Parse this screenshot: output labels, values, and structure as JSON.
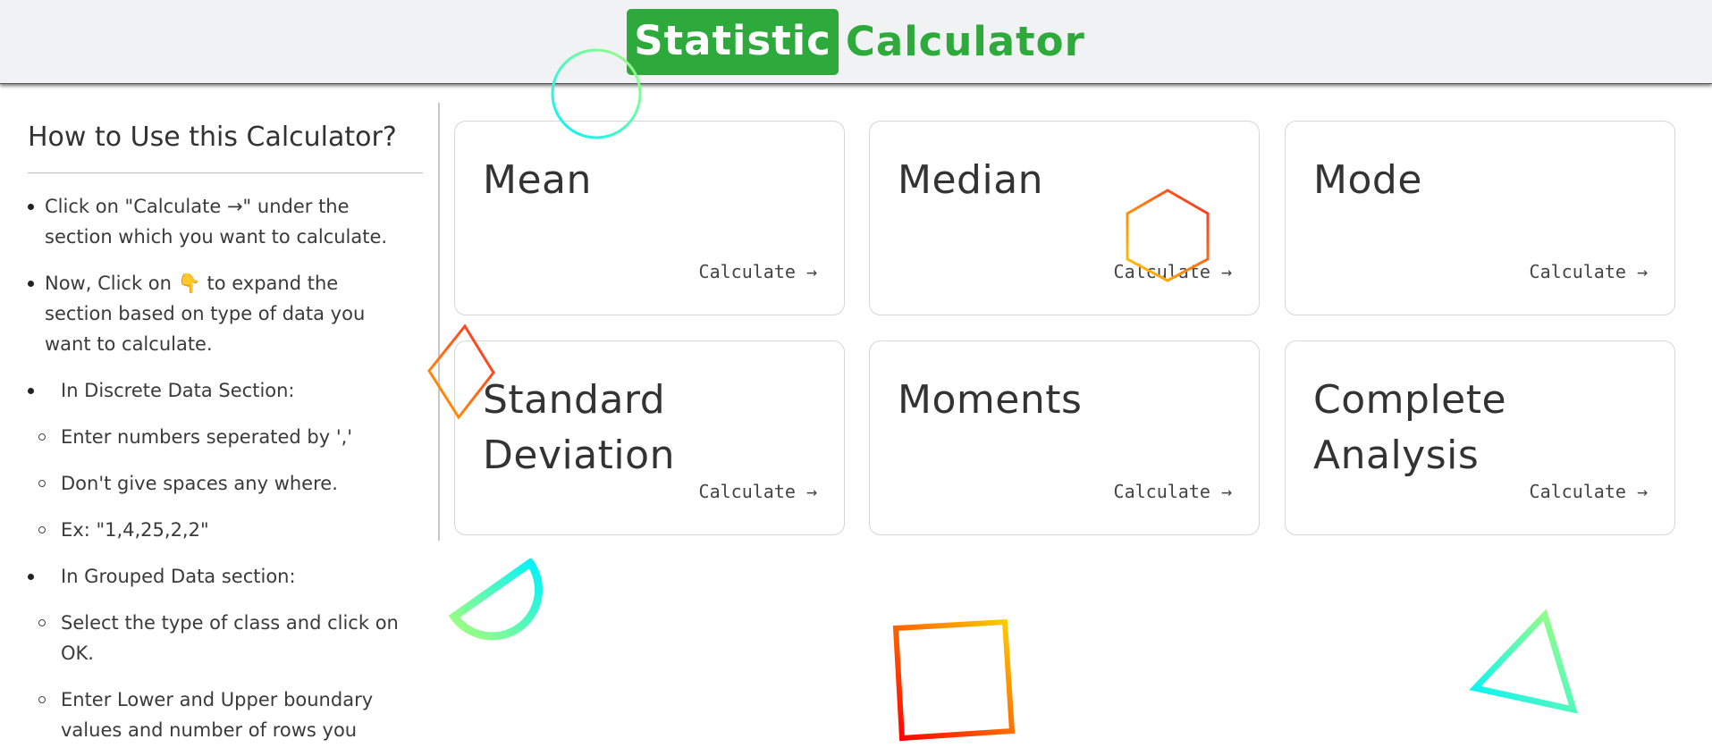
{
  "header": {
    "brand_box": "Statistic",
    "brand_text": "Calculator",
    "brand_color": "#2eaa3c"
  },
  "sidebar": {
    "title": "How to Use this Calculator?",
    "items": [
      {
        "text": "Click on \"Calculate →\" under the section which you want to calculate.",
        "level": 1
      },
      {
        "text_before": "Now, Click on ",
        "emoji": "👇",
        "text_after": " to expand the section based on type of data you want to calculate.",
        "level": 1
      },
      {
        "text": "In Discrete Data Section:",
        "level": 1
      },
      {
        "text": "Enter numbers seperated by ','",
        "level": 2
      },
      {
        "text": "Don't give spaces any where.",
        "level": 2
      },
      {
        "text": "Ex: \"1,4,25,2,2\"",
        "level": 2
      },
      {
        "text": "In Grouped Data section:",
        "level": 1
      },
      {
        "text": "Select the type of class and click on OK.",
        "level": 2
      },
      {
        "text": "Enter Lower and Upper boundary values and number of rows you",
        "level": 2
      }
    ]
  },
  "cards": [
    {
      "title": "Mean",
      "link": "Calculate →"
    },
    {
      "title": "Median",
      "link": "Calculate →"
    },
    {
      "title": "Mode",
      "link": "Calculate →"
    },
    {
      "title": "Standard Deviation",
      "link": "Calculate →"
    },
    {
      "title": "Moments",
      "link": "Calculate →"
    },
    {
      "title": "Complete Analysis",
      "link": "Calculate →"
    }
  ],
  "decorations": [
    {
      "name": "circle-shape",
      "colors": [
        "#00f2ff",
        "#a8ff78"
      ]
    },
    {
      "name": "hexagon-shape",
      "colors": [
        "#ff2a2a",
        "#ffcc00"
      ]
    },
    {
      "name": "diamond-shape",
      "colors": [
        "#ff2a2a",
        "#ffa500"
      ]
    },
    {
      "name": "half-circle-shape",
      "colors": [
        "#00f2ff",
        "#a8ff78"
      ]
    },
    {
      "name": "square-shape",
      "colors": [
        "#ff0000",
        "#ffd000"
      ]
    },
    {
      "name": "triangle-shape",
      "colors": [
        "#00f2ff",
        "#a8ff78"
      ]
    }
  ]
}
